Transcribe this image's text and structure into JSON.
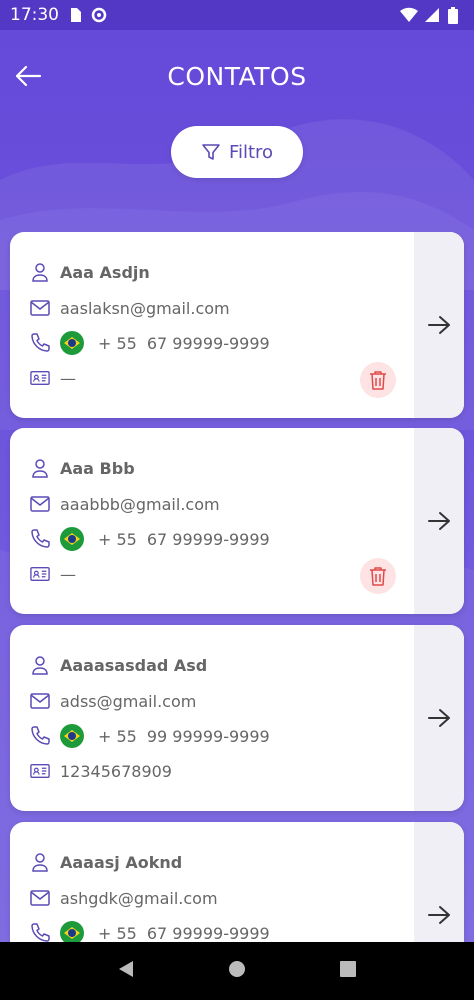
{
  "status_bar": {
    "time": "17:30"
  },
  "header": {
    "title": "CONTATOS"
  },
  "filter": {
    "label": "Filtro"
  },
  "contacts": [
    {
      "name": "Aaa Asdjn",
      "email": "aaslaksn@gmail.com",
      "country_code": "+ 55",
      "phone": "67 99999-9999",
      "document": "—",
      "deletable": true
    },
    {
      "name": "Aaa Bbb",
      "email": "aaabbb@gmail.com",
      "country_code": "+ 55",
      "phone": "67 99999-9999",
      "document": "—",
      "deletable": true
    },
    {
      "name": "Aaaasasdad Asd",
      "email": "adss@gmail.com",
      "country_code": "+ 55",
      "phone": "99 99999-9999",
      "document": "12345678909",
      "deletable": false
    },
    {
      "name": "Aaaasj Aoknd",
      "email": "ashgdk@gmail.com",
      "country_code": "+ 55",
      "phone": "67 99999-9999",
      "document": "",
      "deletable": false
    }
  ],
  "colors": {
    "accent": "#6a52d6",
    "icon": "#5a4bb5",
    "delete": "#e04a4a",
    "delete_bg": "#fde3e3"
  }
}
